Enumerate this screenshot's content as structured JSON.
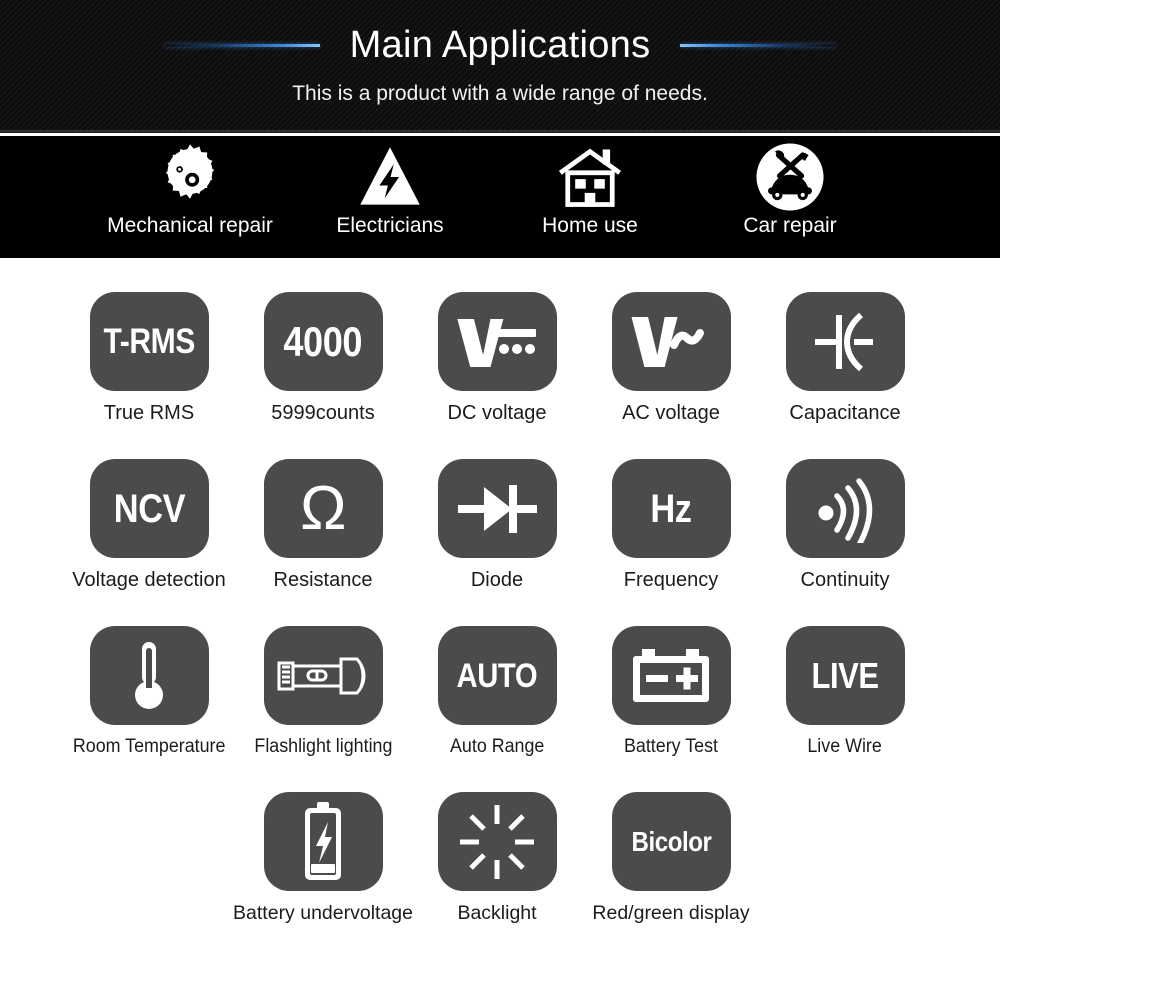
{
  "header": {
    "title": "Main Applications",
    "subtitle": "This is a product with a wide range of needs.",
    "accent_color": "#3b86d8",
    "background_color": "#0d0d0d"
  },
  "applications": [
    {
      "label": "Mechanical repair",
      "icon": "gear-icon"
    },
    {
      "label": "Electricians",
      "icon": "high-voltage-triangle-icon"
    },
    {
      "label": "Home use",
      "icon": "house-icon"
    },
    {
      "label": "Car repair",
      "icon": "car-repair-icon"
    }
  ],
  "features": {
    "tile_color": "#4b4b4b",
    "label_color": "#1c1c1c",
    "rows": [
      [
        {
          "label": "True RMS",
          "tile_text": "T-RMS",
          "icon": "t-rms-text-icon"
        },
        {
          "label": "5999counts",
          "tile_text": "4000",
          "icon": "count-number-text-icon"
        },
        {
          "label": "DC voltage",
          "tile_text": "",
          "icon": "dc-voltage-icon"
        },
        {
          "label": "AC voltage",
          "tile_text": "",
          "icon": "ac-voltage-icon"
        },
        {
          "label": "Capacitance",
          "tile_text": "",
          "icon": "capacitor-icon"
        }
      ],
      [
        {
          "label": "Voltage detection",
          "tile_text": "NCV",
          "icon": "ncv-text-icon"
        },
        {
          "label": "Resistance",
          "tile_text": "Ω",
          "icon": "omega-icon"
        },
        {
          "label": "Diode",
          "tile_text": "",
          "icon": "diode-icon"
        },
        {
          "label": "Frequency",
          "tile_text": "Hz",
          "icon": "hz-text-icon"
        },
        {
          "label": "Continuity",
          "tile_text": "",
          "icon": "continuity-buzzer-icon"
        }
      ],
      [
        {
          "label": "Room Temperature",
          "tile_text": "",
          "icon": "thermometer-icon"
        },
        {
          "label": "Flashlight lighting",
          "tile_text": "",
          "icon": "flashlight-icon"
        },
        {
          "label": "Auto Range",
          "tile_text": "AUTO",
          "icon": "auto-text-icon"
        },
        {
          "label": "Battery Test",
          "tile_text": "",
          "icon": "car-battery-icon"
        },
        {
          "label": "Live Wire",
          "tile_text": "LIVE",
          "icon": "live-text-icon"
        }
      ],
      [
        {
          "label": "Battery undervoltage",
          "tile_text": "",
          "icon": "battery-bolt-icon"
        },
        {
          "label": "Backlight",
          "tile_text": "",
          "icon": "backlight-sunburst-icon"
        },
        {
          "label": "Red/green display",
          "tile_text": "Bicolor",
          "icon": "bicolor-text-icon"
        }
      ]
    ]
  }
}
